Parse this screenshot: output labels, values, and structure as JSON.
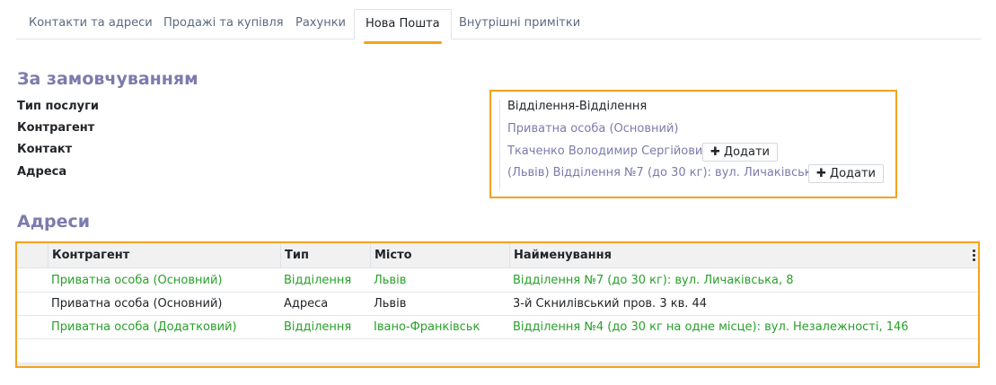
{
  "tabs": [
    {
      "label": "Контакти та адреси"
    },
    {
      "label": "Продажі та купівля"
    },
    {
      "label": "Рахунки"
    },
    {
      "label": "Нова Пошта"
    },
    {
      "label": "Внутрішні примітки"
    }
  ],
  "active_tab": "Нова Пошта",
  "defaults": {
    "heading": "За замовчуванням",
    "fields": {
      "service_type": {
        "label": "Тип послуги",
        "value": "Відділення-Відділення"
      },
      "counterparty": {
        "label": "Контрагент",
        "value": "Приватна особа (Основний)"
      },
      "contact": {
        "label": "Контакт",
        "value": "Ткаченко Володимир Сергійович"
      },
      "address": {
        "label": "Адреса",
        "value": "(Львів) Відділення №7 (до 30 кг): вул. Личаківська, 8"
      }
    },
    "add_label": "Додати",
    "highlight_color": "#f5a21b"
  },
  "addresses": {
    "heading": "Адреси",
    "columns": [
      "Контрагент",
      "Тип",
      "Місто",
      "Найменування"
    ],
    "rows": [
      {
        "counterparty": "Приватна особа (Основний)",
        "type": "Відділення",
        "city": "Львів",
        "name": "Відділення №7 (до 30 кг): вул. Личаківська, 8",
        "status_color": "#28a02a"
      },
      {
        "counterparty": "Приватна особа (Основний)",
        "type": "Адреса",
        "city": "Львів",
        "name": "3-й Скнилівський пров. 3 кв. 44",
        "status_color": "#212529"
      },
      {
        "counterparty": "Приватна особа (Додатковий)",
        "type": "Відділення",
        "city": "Івано-Франківськ",
        "name": "Відділення №4 (до 30 кг на одне місце): вул. Незалежності, 146",
        "status_color": "#28a02a"
      }
    ]
  },
  "colors": {
    "accent": "#f5a21b",
    "heading": "#7c7bad",
    "link": "#7c7bad",
    "active_row": "#28a02a"
  }
}
